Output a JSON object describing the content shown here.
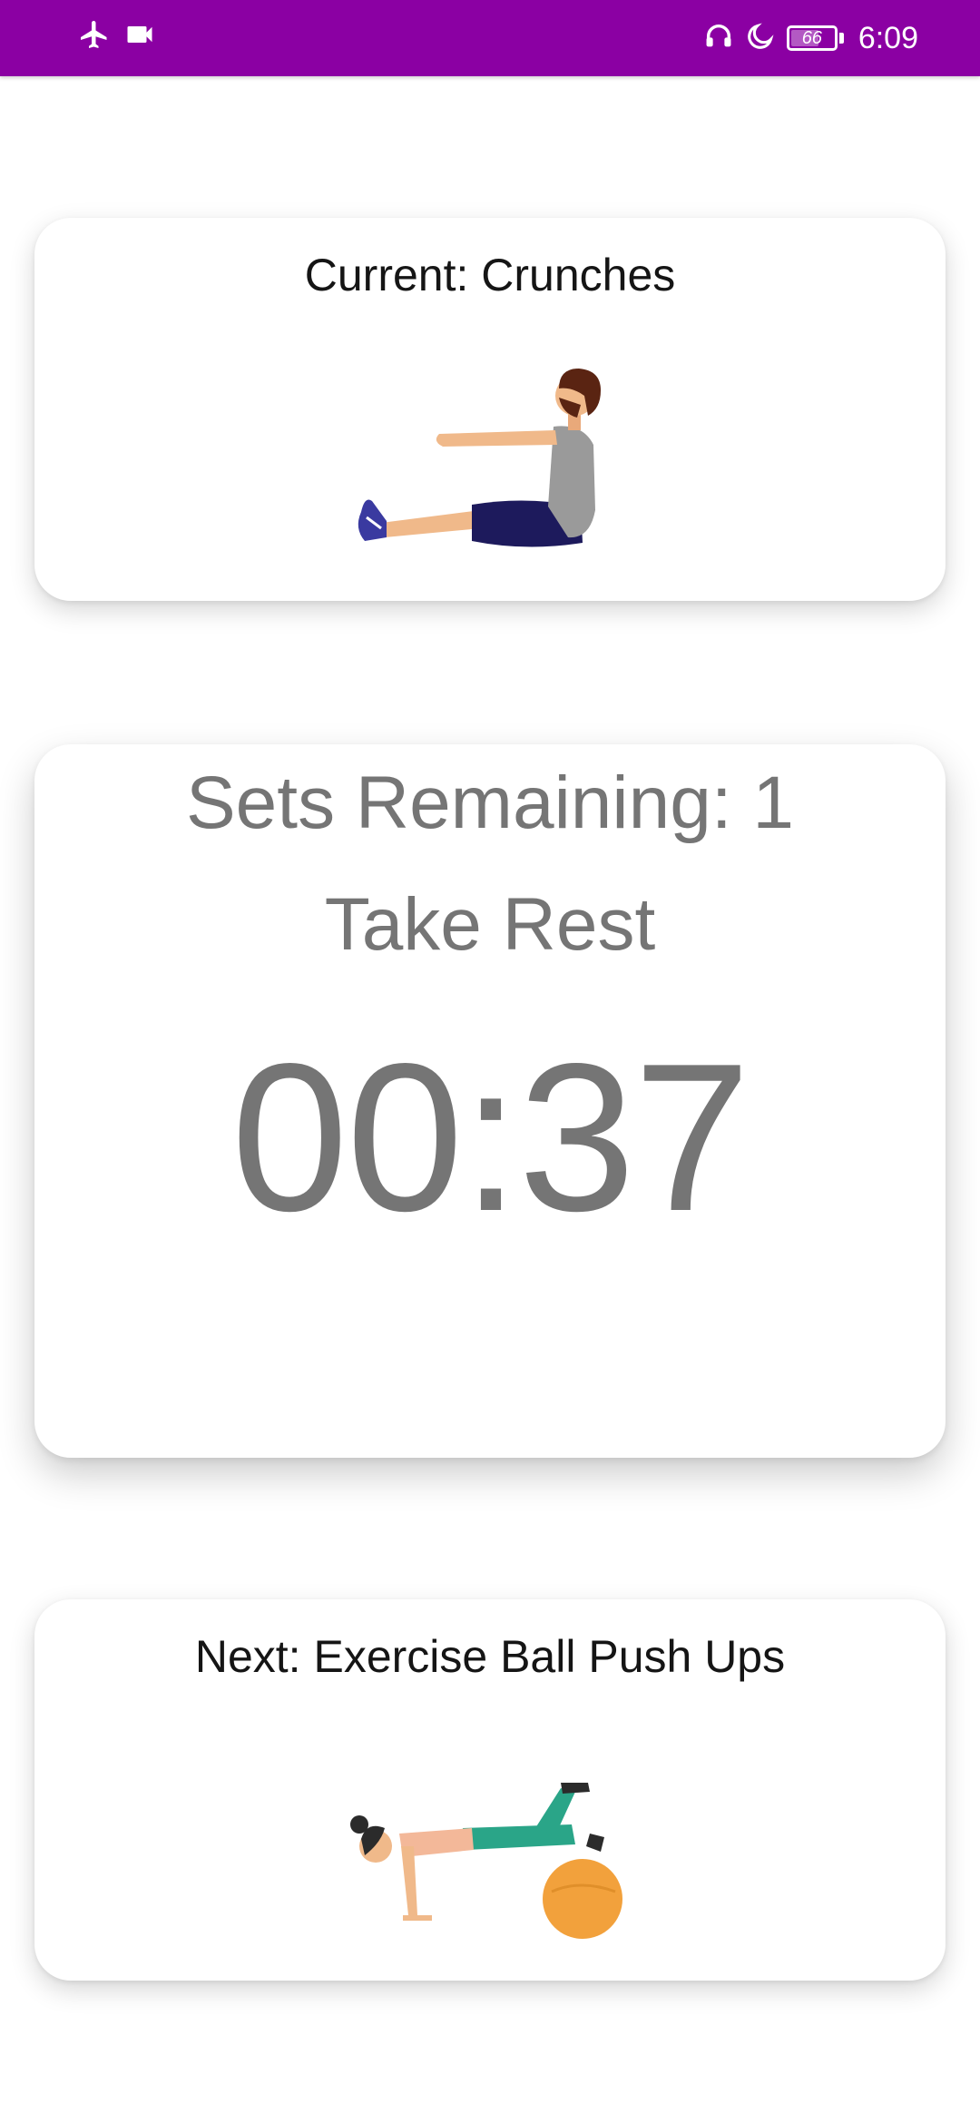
{
  "status_bar": {
    "time": "6:09",
    "battery_level": "66",
    "battery_fraction": 0.66,
    "left_icons": [
      "airplane-icon",
      "video-camera-icon"
    ],
    "right_icons": [
      "headset-icon",
      "moon-icon",
      "battery-icon"
    ],
    "color": "#8b00a3"
  },
  "current_card": {
    "label": "Current: Crunches",
    "illustration": "crunches-illustration"
  },
  "timer_card": {
    "sets_remaining": "Sets Remaining: 1",
    "status": "Take Rest",
    "countdown": "00:37",
    "text_color": "#757575"
  },
  "next_card": {
    "label": "Next: Exercise Ball Push Ups",
    "illustration": "exercise-ball-push-ups-illustration"
  }
}
